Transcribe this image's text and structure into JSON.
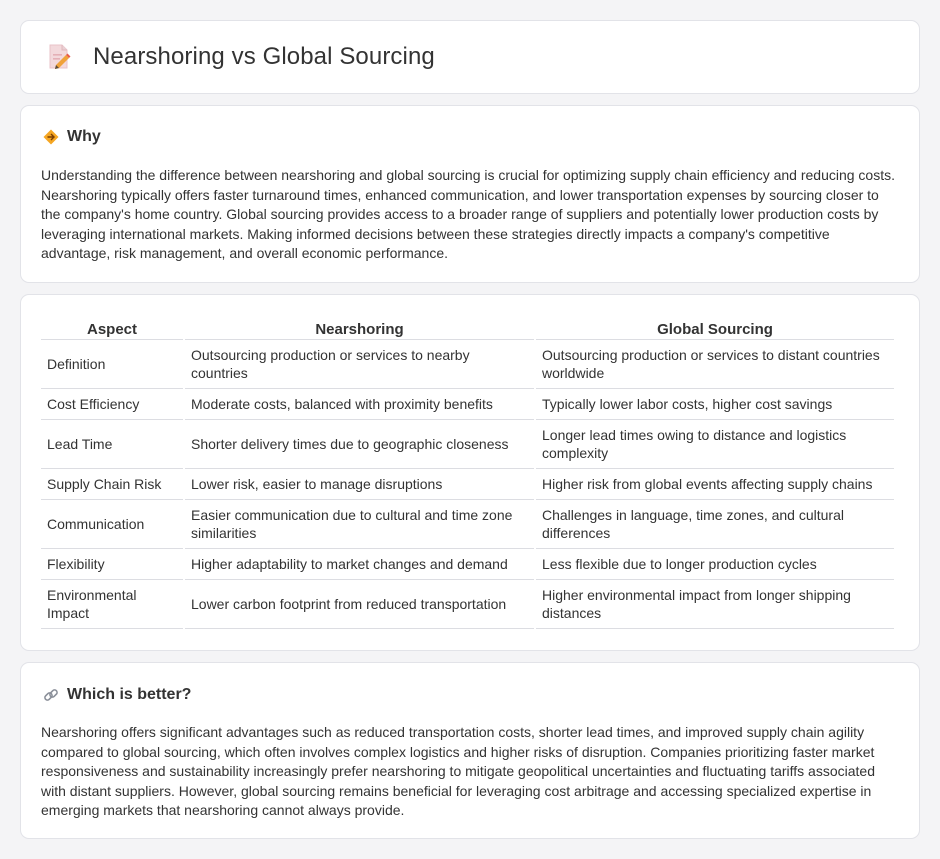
{
  "header": {
    "title": "Nearshoring vs Global Sourcing",
    "icon": "document-pencil-icon"
  },
  "why": {
    "title": "Why",
    "icon": "diamond-signal-icon",
    "text": "Understanding the difference between nearshoring and global sourcing is crucial for optimizing supply chain efficiency and reducing costs. Nearshoring typically offers faster turnaround times, enhanced communication, and lower transportation expenses by sourcing closer to the company's home country. Global sourcing provides access to a broader range of suppliers and potentially lower production costs by leveraging international markets. Making informed decisions between these strategies directly impacts a company's competitive advantage, risk management, and overall economic performance."
  },
  "table": {
    "headers": [
      "Aspect",
      "Nearshoring",
      "Global Sourcing"
    ],
    "rows": [
      [
        "Definition",
        "Outsourcing production or services to nearby countries",
        "Outsourcing production or services to distant countries worldwide"
      ],
      [
        "Cost Efficiency",
        "Moderate costs, balanced with proximity benefits",
        "Typically lower labor costs, higher cost savings"
      ],
      [
        "Lead Time",
        "Shorter delivery times due to geographic closeness",
        "Longer lead times owing to distance and logistics complexity"
      ],
      [
        "Supply Chain Risk",
        "Lower risk, easier to manage disruptions",
        "Higher risk from global events affecting supply chains"
      ],
      [
        "Communication",
        "Easier communication due to cultural and time zone similarities",
        "Challenges in language, time zones, and cultural differences"
      ],
      [
        "Flexibility",
        "Higher adaptability to market changes and demand",
        "Less flexible due to longer production cycles"
      ],
      [
        "Environmental Impact",
        "Lower carbon footprint from reduced transportation",
        "Higher environmental impact from longer shipping distances"
      ]
    ]
  },
  "better": {
    "title": "Which is better?",
    "icon": "link-icon",
    "text": "Nearshoring offers significant advantages such as reduced transportation costs, shorter lead times, and improved supply chain agility compared to global sourcing, which often involves complex logistics and higher risks of disruption. Companies prioritizing faster market responsiveness and sustainability increasingly prefer nearshoring to mitigate geopolitical uncertainties and fluctuating tariffs associated with distant suppliers. However, global sourcing remains beneficial for leveraging cost arbitrage and accessing specialized expertise in emerging markets that nearshoring cannot always provide."
  }
}
